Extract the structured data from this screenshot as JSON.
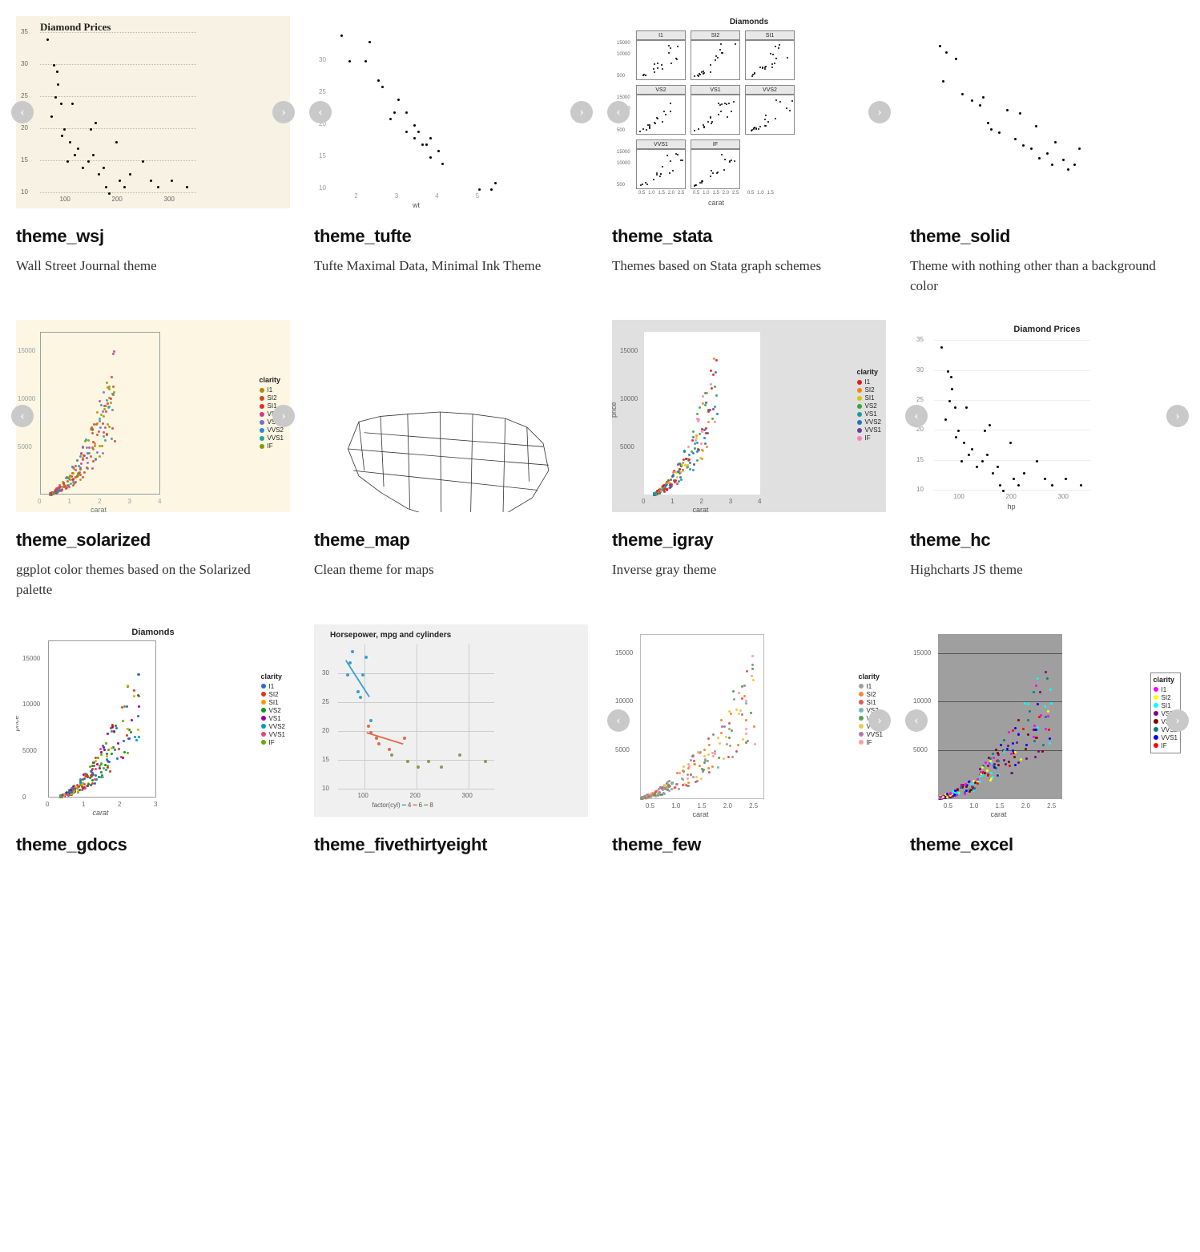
{
  "themes": [
    {
      "id": "wsj",
      "title": "theme_wsj",
      "desc": "Wall Street Journal theme",
      "nav": true
    },
    {
      "id": "tufte",
      "title": "theme_tufte",
      "desc": "Tufte Maximal Data, Minimal Ink Theme",
      "nav": true
    },
    {
      "id": "stata",
      "title": "theme_stata",
      "desc": "Themes based on Stata graph schemes",
      "nav": true
    },
    {
      "id": "solid",
      "title": "theme_solid",
      "desc": "Theme with nothing other than a background color",
      "nav": false
    },
    {
      "id": "solarized",
      "title": "theme_solarized",
      "desc": "ggplot color themes based on the Solarized palette",
      "nav": true
    },
    {
      "id": "map",
      "title": "theme_map",
      "desc": "Clean theme for maps",
      "nav": false
    },
    {
      "id": "igray",
      "title": "theme_igray",
      "desc": "Inverse gray theme",
      "nav": false
    },
    {
      "id": "hc",
      "title": "theme_hc",
      "desc": "Highcharts JS theme",
      "nav": true
    },
    {
      "id": "gdocs",
      "title": "theme_gdocs",
      "desc": "",
      "nav": false
    },
    {
      "id": "fivethirtyeight",
      "title": "theme_fivethirtyeight",
      "desc": "",
      "nav": false
    },
    {
      "id": "few",
      "title": "theme_few",
      "desc": "",
      "nav": true
    },
    {
      "id": "excel",
      "title": "theme_excel",
      "desc": "",
      "nav": true
    }
  ],
  "chart_data": [
    {
      "id": "wsj",
      "type": "scatter",
      "title": "Diamond Prices",
      "xlabel": "",
      "ylabel": "",
      "xlim": [
        50,
        350
      ],
      "ylim": [
        10,
        35
      ],
      "xticks": [
        100,
        200,
        300
      ],
      "yticks": [
        10,
        15,
        20,
        25,
        30,
        35
      ],
      "points": [
        [
          62,
          34
        ],
        [
          75,
          30
        ],
        [
          80,
          29
        ],
        [
          78,
          25
        ],
        [
          82,
          27
        ],
        [
          88,
          24
        ],
        [
          70,
          22
        ],
        [
          90,
          19
        ],
        [
          95,
          20
        ],
        [
          105,
          18
        ],
        [
          110,
          24
        ],
        [
          100,
          15
        ],
        [
          115,
          16
        ],
        [
          120,
          17
        ],
        [
          130,
          14
        ],
        [
          140,
          15
        ],
        [
          150,
          16
        ],
        [
          160,
          13
        ],
        [
          145,
          20
        ],
        [
          155,
          21
        ],
        [
          170,
          14
        ],
        [
          175,
          11
        ],
        [
          180,
          10
        ],
        [
          195,
          18
        ],
        [
          200,
          12
        ],
        [
          210,
          11
        ],
        [
          220,
          13
        ],
        [
          245,
          15
        ],
        [
          260,
          12
        ],
        [
          275,
          11
        ],
        [
          300,
          12
        ],
        [
          330,
          11
        ]
      ]
    },
    {
      "id": "tufte",
      "type": "scatter",
      "title": "",
      "xlabel": "wt",
      "ylabel": "",
      "xlim": [
        1.5,
        5.5
      ],
      "ylim": [
        10,
        35
      ],
      "xticks": [
        2,
        3,
        4,
        5
      ],
      "yticks": [
        10,
        15,
        20,
        25,
        30
      ],
      "points": [
        [
          1.6,
          34
        ],
        [
          1.8,
          30
        ],
        [
          2.2,
          30
        ],
        [
          2.3,
          33
        ],
        [
          2.5,
          27
        ],
        [
          2.6,
          26
        ],
        [
          2.8,
          21
        ],
        [
          2.9,
          22
        ],
        [
          3.0,
          24
        ],
        [
          3.2,
          22
        ],
        [
          3.2,
          19
        ],
        [
          3.4,
          18
        ],
        [
          3.4,
          20
        ],
        [
          3.5,
          19
        ],
        [
          3.6,
          17
        ],
        [
          3.7,
          17
        ],
        [
          3.8,
          15
        ],
        [
          3.8,
          18
        ],
        [
          4.0,
          16
        ],
        [
          4.1,
          14
        ],
        [
          5.0,
          10
        ],
        [
          5.3,
          10
        ],
        [
          5.4,
          11
        ]
      ]
    },
    {
      "id": "stata",
      "type": "scatter",
      "title": "Diamonds",
      "facets": [
        "I1",
        "SI2",
        "SI1",
        "VS2",
        "VS1",
        "VVS2",
        "VVS1",
        "IF"
      ],
      "xlabel": "carat",
      "ylabel": "",
      "xlim": [
        0.5,
        2.5
      ],
      "ylim": [
        500,
        15000
      ],
      "xticks": [
        0.5,
        1.0,
        1.5,
        2.0,
        2.5
      ],
      "yticks": [
        500,
        10000,
        15000
      ]
    },
    {
      "id": "solid",
      "type": "scatter",
      "title": "",
      "xlabel": "",
      "ylabel": "",
      "xlim": [
        0,
        1
      ],
      "ylim": [
        0,
        1
      ],
      "points": [
        [
          0.08,
          0.92
        ],
        [
          0.12,
          0.88
        ],
        [
          0.18,
          0.84
        ],
        [
          0.1,
          0.7
        ],
        [
          0.22,
          0.62
        ],
        [
          0.28,
          0.58
        ],
        [
          0.33,
          0.55
        ],
        [
          0.38,
          0.44
        ],
        [
          0.35,
          0.6
        ],
        [
          0.4,
          0.4
        ],
        [
          0.45,
          0.38
        ],
        [
          0.5,
          0.52
        ],
        [
          0.55,
          0.34
        ],
        [
          0.6,
          0.3
        ],
        [
          0.58,
          0.5
        ],
        [
          0.65,
          0.28
        ],
        [
          0.68,
          0.42
        ],
        [
          0.7,
          0.22
        ],
        [
          0.75,
          0.25
        ],
        [
          0.78,
          0.18
        ],
        [
          0.8,
          0.32
        ],
        [
          0.85,
          0.21
        ],
        [
          0.88,
          0.15
        ],
        [
          0.92,
          0.18
        ],
        [
          0.95,
          0.28
        ]
      ]
    },
    {
      "id": "solarized",
      "type": "scatter",
      "title": "",
      "xlabel": "carat",
      "ylabel": "",
      "xlim": [
        0,
        4
      ],
      "ylim": [
        0,
        17000
      ],
      "xticks": [
        0,
        1,
        2,
        3,
        4
      ],
      "yticks": [
        5000,
        10000,
        15000
      ],
      "legend_title": "clarity",
      "legend": [
        "I1",
        "SI2",
        "SI1",
        "VS2",
        "VS1",
        "VVS2",
        "VVS1",
        "IF"
      ],
      "legend_colors": [
        "#b58900",
        "#cb4b16",
        "#dc322f",
        "#d33682",
        "#6c71c4",
        "#268bd2",
        "#2aa198",
        "#859900"
      ]
    },
    {
      "id": "map",
      "type": "map",
      "title": ""
    },
    {
      "id": "igray",
      "type": "scatter",
      "title": "",
      "xlabel": "carat",
      "ylabel": "price",
      "xlim": [
        0,
        4
      ],
      "ylim": [
        0,
        17000
      ],
      "xticks": [
        0,
        1,
        2,
        3,
        4
      ],
      "yticks": [
        5000,
        10000,
        15000
      ],
      "legend_title": "clarity",
      "legend": [
        "I1",
        "SI2",
        "SI1",
        "VS2",
        "VS1",
        "VVS2",
        "VVS1",
        "IF"
      ],
      "legend_colors": [
        "#e41a1c",
        "#ff7f0e",
        "#cccc00",
        "#33aa33",
        "#1f9999",
        "#1f77b4",
        "#6a3d9a",
        "#f781bf"
      ]
    },
    {
      "id": "hc",
      "type": "scatter",
      "title": "Diamond Prices",
      "xlabel": "hp",
      "ylabel": "",
      "xlim": [
        50,
        350
      ],
      "ylim": [
        10,
        35
      ],
      "xticks": [
        100,
        200,
        300
      ],
      "yticks": [
        10,
        15,
        20,
        25,
        30,
        35
      ],
      "points": [
        [
          62,
          34
        ],
        [
          75,
          30
        ],
        [
          80,
          29
        ],
        [
          78,
          25
        ],
        [
          82,
          27
        ],
        [
          88,
          24
        ],
        [
          70,
          22
        ],
        [
          90,
          19
        ],
        [
          95,
          20
        ],
        [
          105,
          18
        ],
        [
          110,
          24
        ],
        [
          100,
          15
        ],
        [
          115,
          16
        ],
        [
          120,
          17
        ],
        [
          130,
          14
        ],
        [
          140,
          15
        ],
        [
          150,
          16
        ],
        [
          160,
          13
        ],
        [
          145,
          20
        ],
        [
          155,
          21
        ],
        [
          170,
          14
        ],
        [
          175,
          11
        ],
        [
          180,
          10
        ],
        [
          195,
          18
        ],
        [
          200,
          12
        ],
        [
          210,
          11
        ],
        [
          220,
          13
        ],
        [
          245,
          15
        ],
        [
          260,
          12
        ],
        [
          275,
          11
        ],
        [
          300,
          12
        ],
        [
          330,
          11
        ]
      ]
    },
    {
      "id": "gdocs",
      "type": "scatter",
      "title": "Diamonds",
      "xlabel": "carat",
      "ylabel": "price",
      "xlim": [
        0,
        3
      ],
      "ylim": [
        0,
        17000
      ],
      "xticks": [
        0,
        1,
        2,
        3
      ],
      "yticks": [
        0,
        5000,
        10000,
        15000
      ],
      "legend_title": "clarity",
      "legend": [
        "I1",
        "SI2",
        "SI1",
        "VS2",
        "VS1",
        "VVS2",
        "VVS1",
        "IF"
      ],
      "legend_colors": [
        "#3366cc",
        "#dc3912",
        "#ff9900",
        "#109618",
        "#990099",
        "#0099c6",
        "#dd4477",
        "#66aa00"
      ]
    },
    {
      "id": "fivethirtyeight",
      "type": "line",
      "title": "Horsepower, mpg and cylinders",
      "xlabel": "",
      "ylabel": "",
      "xlim": [
        50,
        350
      ],
      "ylim": [
        10,
        35
      ],
      "xticks": [
        100,
        200,
        300
      ],
      "yticks": [
        10,
        15,
        20,
        25,
        30
      ],
      "legend_title": "factor(cyl)",
      "series": [
        {
          "name": "4",
          "color": "#3c9dd0",
          "points": [
            [
              65,
              30
            ],
            [
              70,
              32
            ],
            [
              75,
              34
            ],
            [
              85,
              27
            ],
            [
              90,
              26
            ],
            [
              95,
              30
            ],
            [
              110,
              22
            ],
            [
              100,
              33
            ]
          ]
        },
        {
          "name": "6",
          "color": "#e06c44",
          "points": [
            [
              105,
              21
            ],
            [
              110,
              20
            ],
            [
              120,
              19
            ],
            [
              125,
              18
            ],
            [
              145,
              17
            ],
            [
              175,
              19
            ]
          ]
        },
        {
          "name": "8",
          "color": "#8a9b4b",
          "points": [
            [
              150,
              16
            ],
            [
              180,
              15
            ],
            [
              200,
              14
            ],
            [
              220,
              15
            ],
            [
              245,
              14
            ],
            [
              280,
              16
            ],
            [
              330,
              15
            ]
          ]
        }
      ]
    },
    {
      "id": "few",
      "type": "scatter",
      "title": "",
      "xlabel": "carat",
      "ylabel": "",
      "xlim": [
        0.3,
        2.7
      ],
      "ylim": [
        0,
        17000
      ],
      "xticks": [
        0.5,
        1.0,
        1.5,
        2.0,
        2.5
      ],
      "yticks": [
        5000,
        10000,
        15000
      ],
      "legend_title": "clarity",
      "legend": [
        "I1",
        "SI2",
        "SI1",
        "VS2",
        "VS1",
        "VVS2",
        "VVS1",
        "IF"
      ],
      "legend_colors": [
        "#9e9e9e",
        "#f28e2b",
        "#e15759",
        "#76b7b2",
        "#59a14f",
        "#edc948",
        "#b07aa1",
        "#ff9da7"
      ]
    },
    {
      "id": "excel",
      "type": "scatter",
      "title": "",
      "xlabel": "carat",
      "ylabel": "",
      "xlim": [
        0.3,
        2.7
      ],
      "ylim": [
        0,
        17000
      ],
      "xticks": [
        0.5,
        1.0,
        1.5,
        2.0,
        2.5
      ],
      "yticks": [
        5000,
        10000,
        15000
      ],
      "legend_title": "clarity",
      "legend": [
        "I1",
        "SI2",
        "SI1",
        "VS2",
        "VS1",
        "VVS2",
        "VVS1",
        "IF"
      ],
      "legend_colors": [
        "#ff00ff",
        "#ffff00",
        "#00ffff",
        "#800080",
        "#800000",
        "#008080",
        "#0000ff",
        "#ff0000"
      ]
    }
  ],
  "nav": {
    "prev": "‹",
    "next": "›"
  }
}
